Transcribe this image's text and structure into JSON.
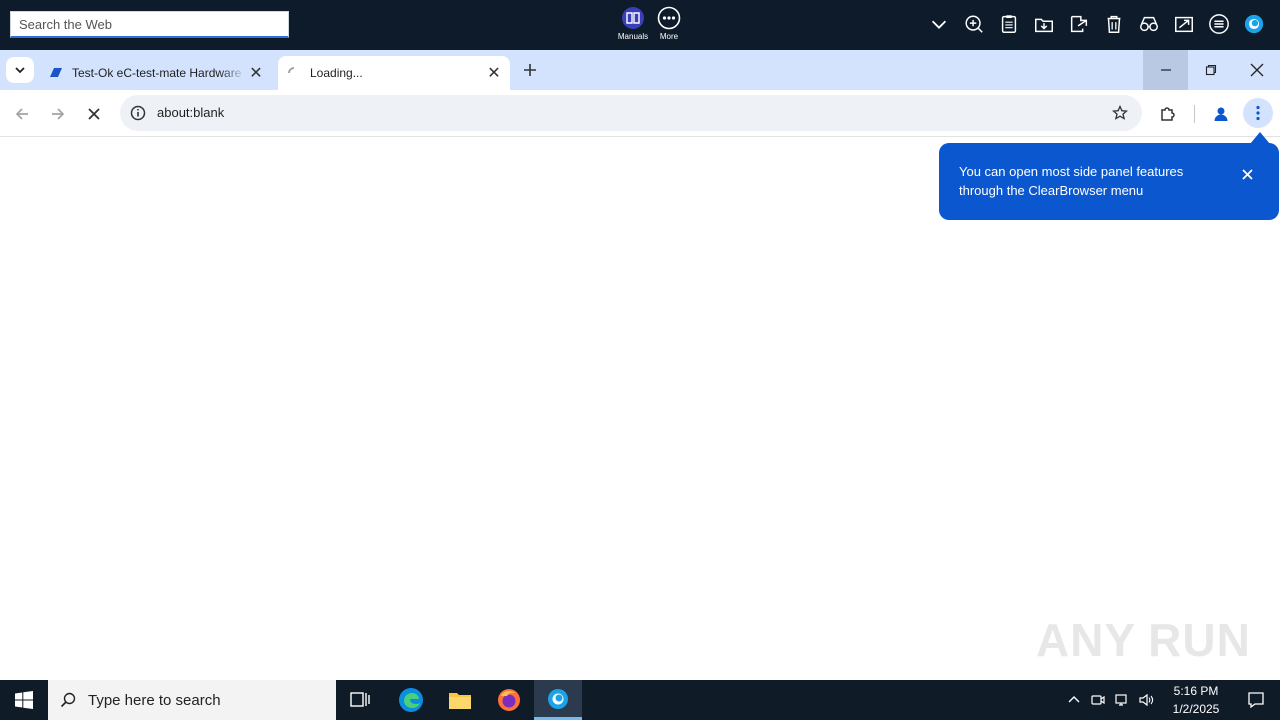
{
  "topbar": {
    "search_placeholder": "Search the Web",
    "center_items": [
      {
        "label": "Manuals",
        "icon": "book-icon"
      },
      {
        "label": "More",
        "icon": "more-icon"
      }
    ],
    "right_icons": [
      "chevron-down-icon",
      "zoom-in-icon",
      "clipboard-icon",
      "folder-download-icon",
      "share-icon",
      "trash-icon",
      "glasses-icon",
      "send-icon",
      "list-icon",
      "clearbrowser-logo-icon"
    ]
  },
  "tabs": [
    {
      "title": "Test-Ok eC-test-mate Hardware",
      "state": "inactive"
    },
    {
      "title": "Loading...",
      "state": "active"
    }
  ],
  "address_bar": {
    "url": "about:blank"
  },
  "callout": {
    "text": "You can open most side panel features through the ClearBrowser menu"
  },
  "watermark": {
    "text_left": "ANY",
    "text_right": "RUN"
  },
  "taskbar": {
    "search_placeholder": "Type here to search",
    "time": "5:16 PM",
    "date": "1/2/2025"
  },
  "colors": {
    "accent": "#0b57d0",
    "tabstrip": "#d3e3fd",
    "taskbar": "#101b28",
    "topbar": "#0d1b2a"
  }
}
